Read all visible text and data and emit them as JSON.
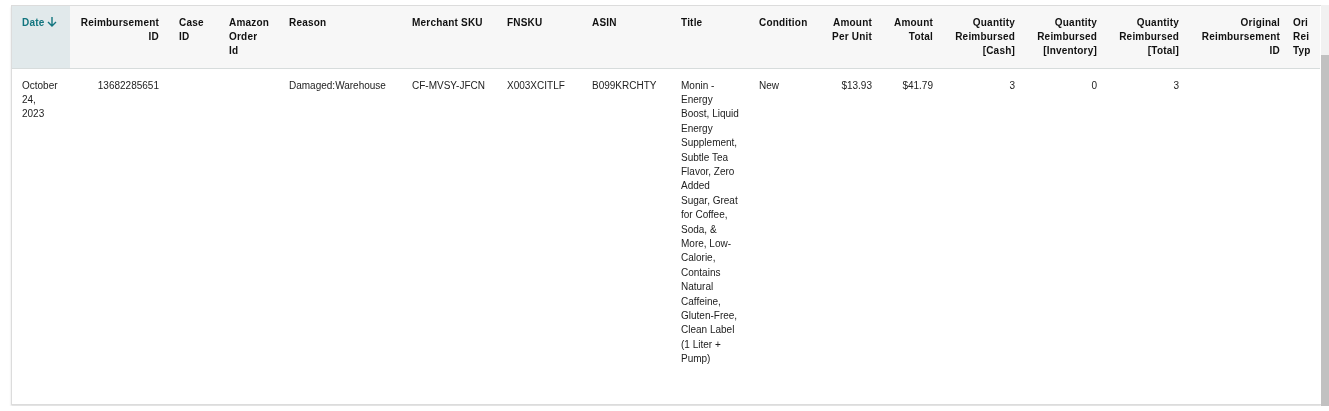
{
  "table": {
    "columns": [
      {
        "label": "Date",
        "sorted": true
      },
      {
        "label": "Reimbursement ID",
        "sorted": false
      },
      {
        "label": "Case ID",
        "sorted": false
      },
      {
        "label": "Amazon Order Id",
        "sorted": false
      },
      {
        "label": "Reason",
        "sorted": false
      },
      {
        "label": "Merchant SKU",
        "sorted": false
      },
      {
        "label": "FNSKU",
        "sorted": false
      },
      {
        "label": "ASIN",
        "sorted": false
      },
      {
        "label": "Title",
        "sorted": false
      },
      {
        "label": "Condition",
        "sorted": false
      },
      {
        "label": "Amount Per Unit",
        "sorted": false
      },
      {
        "label": "Amount Total",
        "sorted": false
      },
      {
        "label": "Quantity Reimbursed [Cash]",
        "sorted": false
      },
      {
        "label": "Quantity Reimbursed [Inventory]",
        "sorted": false
      },
      {
        "label": "Quantity Reimbursed [Total]",
        "sorted": false
      },
      {
        "label": "Original Reimbursement ID",
        "sorted": false
      },
      {
        "label": "Ori Rei Typ",
        "sorted": false
      }
    ],
    "rows": [
      {
        "cells": [
          "October 24, 2023",
          "13682285651",
          null,
          null,
          "Damaged:Warehouse",
          "CF-MVSY-JFCN",
          "X003XCITLF",
          "B099KRCHTY",
          "Monin - Energy Boost, Liquid Energy Supplement, Subtle Tea Flavor, Zero Added Sugar, Great for Coffee, Soda, & More, Low-Calorie, Contains Natural Caffeine, Gluten-Free, Clean Label (1 Liter + Pump)",
          "New",
          "$13.93",
          "$41.79",
          "3",
          "0",
          "3",
          null,
          null
        ]
      }
    ]
  }
}
